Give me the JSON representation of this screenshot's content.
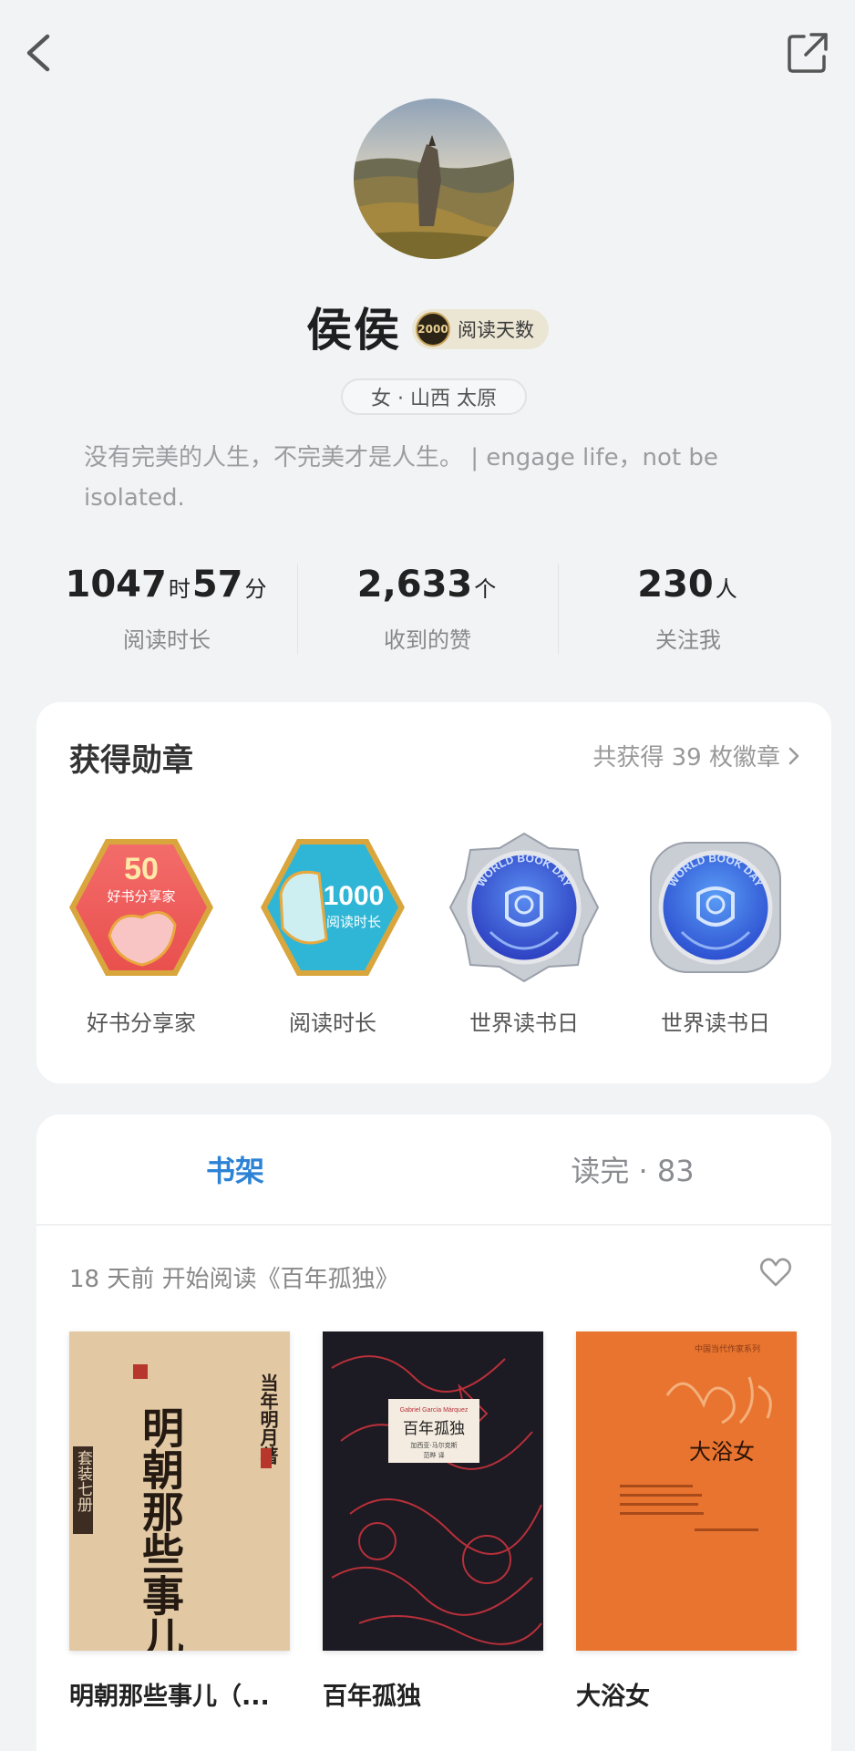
{
  "header": {
    "back_icon": "chevron-left-icon",
    "share_icon": "external-link-icon"
  },
  "profile": {
    "name": "侯侯",
    "read_days_count": "2000",
    "read_days_label": "阅读天数",
    "location": "女 · 山西 太原",
    "bio": "没有完美的人生，不完美才是人生。 | engage life，not be isolated."
  },
  "stats": {
    "reading_hours": "1047",
    "hours_unit": "时",
    "reading_minutes": "57",
    "minutes_unit": "分",
    "reading_label": "阅读时长",
    "likes": "2,633",
    "likes_unit": "个",
    "likes_label": "收到的赞",
    "followers": "230",
    "followers_unit": "人",
    "followers_label": "关注我"
  },
  "medals": {
    "title": "获得勋章",
    "more": "共获得 39 枚徽章",
    "items": [
      {
        "label": "好书分享家",
        "number": "50",
        "sub": "好书分享家"
      },
      {
        "label": "阅读时长",
        "number": "1000",
        "sub": "阅读时长"
      },
      {
        "label": "世界读书日",
        "ring": "WORLD BOOK DAY"
      },
      {
        "label": "世界读书日",
        "ring": "WORLD BOOK DAY"
      }
    ]
  },
  "shelf": {
    "tab_shelf": "书架",
    "tab_finished": "读完 · 83",
    "recent": "18 天前 开始阅读《百年孤独》",
    "books": [
      {
        "title": "明朝那些事儿（...",
        "cover_main": "明朝那些事儿",
        "cover_author": "当年明月著",
        "cover_set": "套装七册"
      },
      {
        "title": "百年孤独",
        "cover_main": "百年孤独",
        "cover_author_en": "Gabriel García Márquez",
        "cover_author": "加西亚·马尔克斯",
        "cover_translator": "范晔 译"
      },
      {
        "title": "大浴女",
        "cover_main": "大浴女",
        "cover_series": "中国当代作家系列"
      }
    ]
  },
  "colors": {
    "accent": "#2c83d6",
    "background": "#f2f3f5"
  }
}
